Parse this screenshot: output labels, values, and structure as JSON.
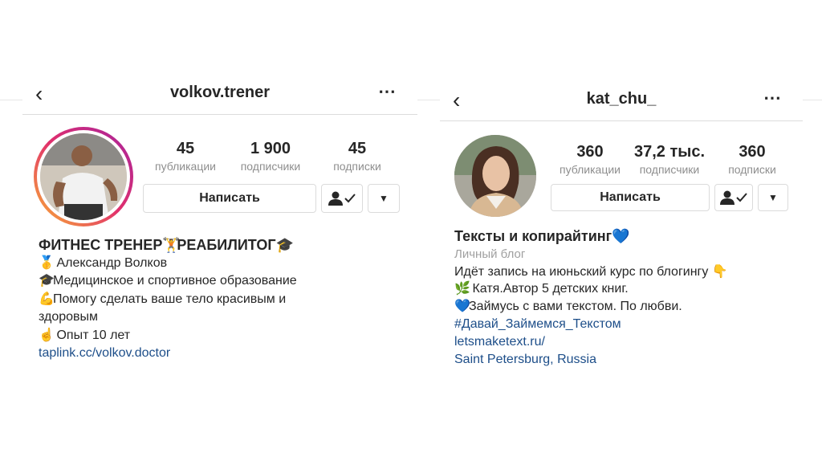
{
  "left_profile": {
    "username": "volkov.trener",
    "back_icon": "chevron-left-icon",
    "more_icon": "ellipsis-icon",
    "stats": [
      {
        "num": "45",
        "label": "публикации"
      },
      {
        "num": "1 900",
        "label": "подписчики"
      },
      {
        "num": "45",
        "label": "подписки"
      }
    ],
    "message_button": "Написать",
    "bio": {
      "title": "ФИТНЕС ТРЕНЕР",
      "title_emoji_1": "🏋",
      "title_2": "РЕАБИЛИТОГ",
      "title_emoji_2": "🎓",
      "line1_emoji": "🥇",
      "line1": "Александр Волков",
      "line2_emoji": "🎓",
      "line2": "Медицинское и спортивное образование",
      "line3_emoji": "💪",
      "line3": "Помогу сделать ваше тело красивым и",
      "line4": "здоровым",
      "line5_emoji": "☝",
      "line5": "Опыт 10 лет",
      "link": "taplink.cc/volkov.doctor"
    }
  },
  "right_profile": {
    "username": "kat_chu_",
    "back_icon": "chevron-left-icon",
    "more_icon": "ellipsis-icon",
    "stats": [
      {
        "num": "360",
        "label": "публикации"
      },
      {
        "num": "37,2 тыс.",
        "label": "подписчики"
      },
      {
        "num": "360",
        "label": "подписки"
      }
    ],
    "message_button": "Написать",
    "bio": {
      "title": "Тексты и копирайтинг",
      "title_emoji": "💙",
      "category": "Личный блог",
      "line1": "Идёт запись на июньский курс по блогингу",
      "line1_emoji": "👇",
      "line2_emoji": "🌿",
      "line2": "Катя.Автор 5 детских книг.",
      "line3_emoji": "💙",
      "line3": "Займусь с вами текстом. По любви.",
      "hashtag": "#Давай_Займемся_Текстом",
      "link": "letsmaketext.ru/",
      "location": "Saint Petersburg, Russia"
    }
  },
  "colors": {
    "link": "#1d4e89",
    "muted": "#8e8e8e",
    "ring_start": "#f9b233",
    "ring_end": "#a6239e"
  }
}
